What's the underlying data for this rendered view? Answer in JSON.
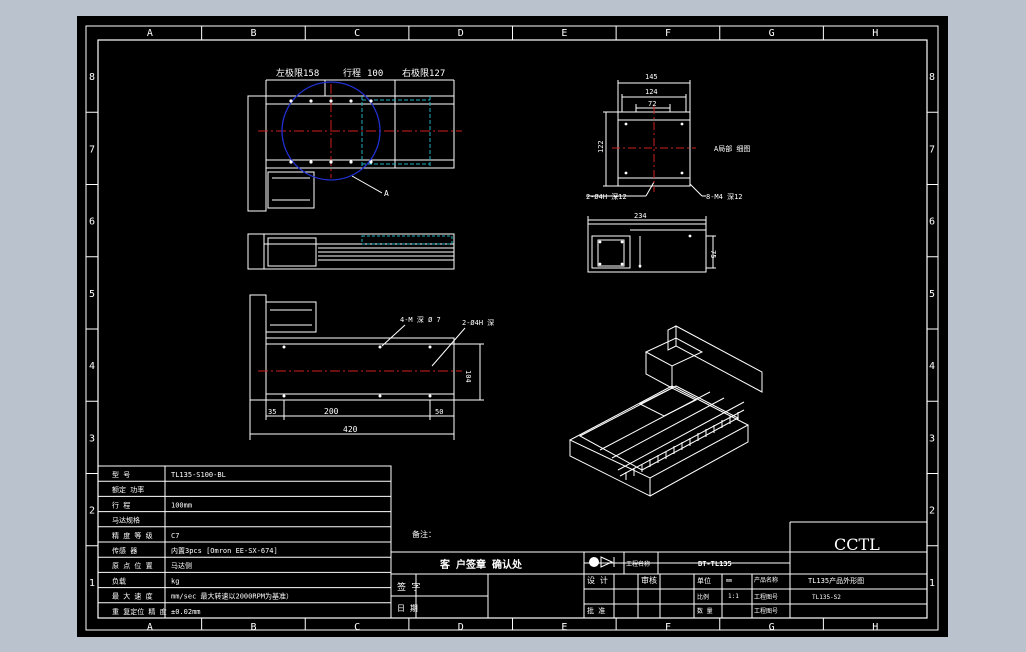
{
  "colors": {
    "background": "#b9c2cd",
    "sheet": "#000000",
    "line": "#ffffff",
    "centerline": "#d02020",
    "hidden": "#20b0c0",
    "circle": "#2030d0"
  },
  "border": {
    "columns": [
      "A",
      "B",
      "C",
      "D",
      "E",
      "F",
      "G",
      "H"
    ],
    "rows": [
      "8",
      "7",
      "6",
      "5",
      "4",
      "3",
      "2",
      "1"
    ]
  },
  "top_view": {
    "dim_left": "左极限158",
    "dim_travel_label": "行程",
    "dim_travel_value": "100",
    "dim_right": "右极限127",
    "leader_a": "A"
  },
  "end_view": {
    "w_outer": "145",
    "w_mid": "124",
    "w_inner": "72",
    "h_left": "122",
    "note_left": "2-Ø4H 深12",
    "note_right": "8-M4 深12",
    "note_side": "A局部 细图"
  },
  "side_view": {
    "dim_width": "234",
    "dim_height": "75"
  },
  "bottom_view": {
    "note_holes": "4-M 深 Ø 7",
    "note_pins": "2-Ø4H 深",
    "dim_left": "35",
    "dim_mid": "200",
    "dim_right": "50",
    "dim_total": "420",
    "dim_height": "104"
  },
  "notes_label": "备注：",
  "param_table": [
    {
      "label": "型 号",
      "value": "TL135-S100-BL"
    },
    {
      "label": "额定 功率",
      "value": ""
    },
    {
      "label": "行 程",
      "value": "100mm"
    },
    {
      "label": "马达规格",
      "value": ""
    },
    {
      "label": "精 度 等 级",
      "value": "C7"
    },
    {
      "label": "传感 器",
      "value": "内置3pcs [Omron EE-SX-674]"
    },
    {
      "label": "原 点 位 置",
      "value": "马达侧"
    },
    {
      "label": "负载",
      "value": "kg"
    },
    {
      "label": "最 大 速 度",
      "value": "mm/sec 最大转速以2000RPM为基准）"
    },
    {
      "label": "重 复定位 精 度",
      "value": "±0.02mm"
    }
  ],
  "title_block": {
    "customer_confirm": "客 户签章 确认处",
    "sign": "签 字",
    "date": "日 期",
    "project_label": "工程名称",
    "project_value": "BT-TL135",
    "design": "设 计",
    "check": "审核",
    "approve": "批 准",
    "unit": "单位",
    "unit_value": "mm",
    "scale": "比例",
    "scale_value": "1:1",
    "qty": "数 量",
    "product_label": "产品名称",
    "product_value": "TL135产品外形图",
    "drawing_no_label": "工程图号",
    "drawing_no_value": "TL135-S2",
    "material": "工程图号",
    "company": "CCTL"
  }
}
